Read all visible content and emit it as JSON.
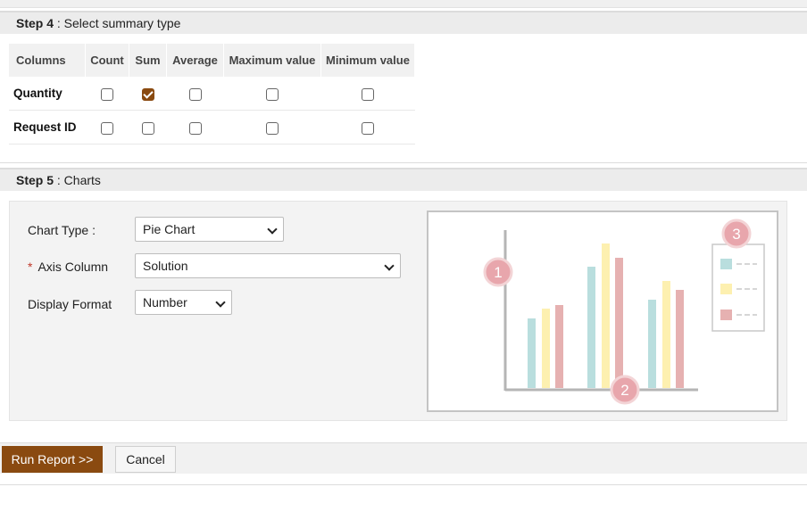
{
  "step4": {
    "label": "Step 4",
    "text": " : Select summary type"
  },
  "summary_table": {
    "headers": [
      "Columns",
      "Count",
      "Sum",
      "Average",
      "Maximum value",
      "Minimum value"
    ],
    "rows": [
      {
        "name": "Quantity",
        "checks": [
          false,
          true,
          false,
          false,
          false
        ]
      },
      {
        "name": "Request ID",
        "checks": [
          false,
          false,
          false,
          false,
          false
        ]
      }
    ]
  },
  "step5": {
    "label": "Step 5",
    "text": " : Charts"
  },
  "chart_form": {
    "chart_type_label": "Chart Type :",
    "chart_type_value": "Pie Chart",
    "required_marker": "*",
    "axis_column_label": "Axis Column",
    "axis_column_value": "Solution",
    "display_format_label": "Display Format",
    "display_format_value": "Number"
  },
  "preview": {
    "markers": [
      "1",
      "2",
      "3"
    ],
    "colors": {
      "teal": "#b9dede",
      "yellow": "#fdf0b0",
      "pink": "#e6b1b1",
      "axis": "#b5b5b5",
      "badge": "#e8a6ac"
    }
  },
  "footer": {
    "run_label": "Run Report >>",
    "cancel_label": "Cancel"
  }
}
